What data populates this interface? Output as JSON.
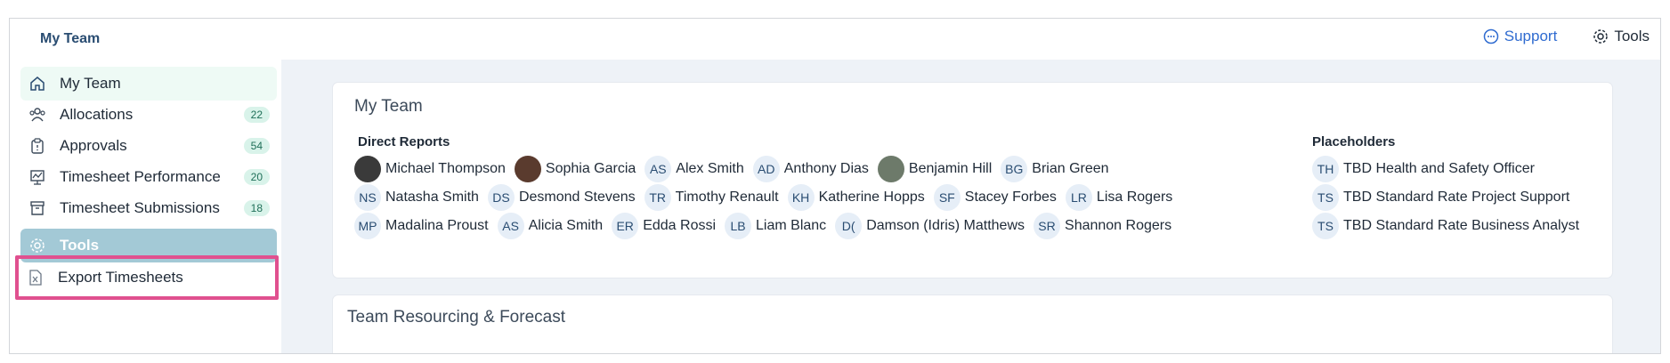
{
  "header": {
    "title": "My Team",
    "support_label": "Support",
    "tools_label": "Tools"
  },
  "sidebar": {
    "items": [
      {
        "label": "My Team",
        "icon": "home-icon"
      },
      {
        "label": "Allocations",
        "icon": "users-icon",
        "badge": "22"
      },
      {
        "label": "Approvals",
        "icon": "clipboard-icon",
        "badge": "54"
      },
      {
        "label": "Timesheet Performance",
        "icon": "chart-icon",
        "badge": "20"
      },
      {
        "label": "Timesheet Submissions",
        "icon": "archive-icon",
        "badge": "18"
      },
      {
        "label": "Tools",
        "icon": "gear-icon"
      },
      {
        "label": "Export Timesheets",
        "icon": "excel-file-icon"
      }
    ]
  },
  "team_card": {
    "title": "My Team",
    "direct_reports_heading": "Direct Reports",
    "placeholders_heading": "Placeholders",
    "direct_reports": [
      [
        {
          "initials": "",
          "name": "Michael Thompson",
          "photo": true
        },
        {
          "initials": "",
          "name": "Sophia Garcia",
          "photo": true
        },
        {
          "initials": "AS",
          "name": "Alex Smith"
        },
        {
          "initials": "AD",
          "name": "Anthony Dias"
        },
        {
          "initials": "",
          "name": "Benjamin Hill",
          "photo": true
        },
        {
          "initials": "BG",
          "name": "Brian Green"
        }
      ],
      [
        {
          "initials": "NS",
          "name": "Natasha Smith"
        },
        {
          "initials": "DS",
          "name": "Desmond Stevens"
        },
        {
          "initials": "TR",
          "name": "Timothy Renault"
        },
        {
          "initials": "KH",
          "name": "Katherine Hopps"
        },
        {
          "initials": "SF",
          "name": "Stacey Forbes"
        },
        {
          "initials": "LR",
          "name": "Lisa Rogers"
        }
      ],
      [
        {
          "initials": "MP",
          "name": "Madalina Proust"
        },
        {
          "initials": "AS",
          "name": "Alicia Smith"
        },
        {
          "initials": "ER",
          "name": "Edda Rossi"
        },
        {
          "initials": "LB",
          "name": "Liam Blanc"
        },
        {
          "initials": "D(",
          "name": "Damson (Idris) Matthews"
        },
        {
          "initials": "SR",
          "name": "Shannon Rogers"
        }
      ]
    ],
    "placeholders": [
      {
        "initials": "TH",
        "name": "TBD Health and Safety Officer"
      },
      {
        "initials": "TS",
        "name": "TBD Standard Rate Project Support"
      },
      {
        "initials": "TS",
        "name": "TBD Standard Rate Business Analyst"
      }
    ]
  },
  "forecast_card": {
    "title": "Team Resourcing & Forecast"
  }
}
